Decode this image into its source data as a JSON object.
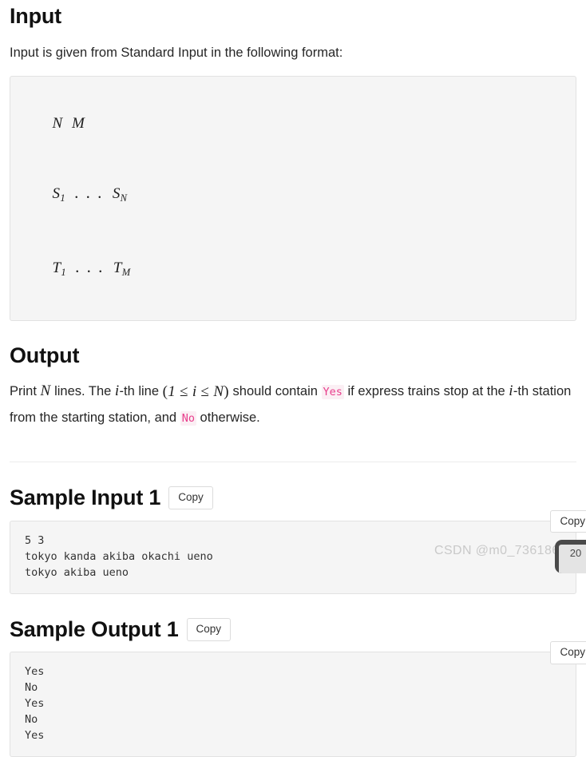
{
  "sections": {
    "input": {
      "heading": "Input",
      "description": "Input is given from Standard Input in the following format:",
      "format_lines": [
        {
          "tokens": [
            {
              "text": "N"
            },
            {
              "text": "M"
            }
          ]
        },
        {
          "tokens": [
            {
              "text": "S",
              "sub": "1"
            },
            {
              "text": "…"
            },
            {
              "text": "S",
              "sub": "N"
            }
          ]
        },
        {
          "tokens": [
            {
              "text": "T",
              "sub": "1"
            },
            {
              "text": "…"
            },
            {
              "text": "T",
              "sub": "M"
            }
          ]
        }
      ],
      "format_plain": "N M\nS_1 ... S_N\nT_1 ... T_M"
    },
    "output": {
      "heading": "Output",
      "text_part_1": "Print ",
      "math_n_1": "N",
      "text_part_2": " lines. The ",
      "math_i_1": "i",
      "text_part_3": "-th line ",
      "math_range": "(1 ≤ i ≤ N)",
      "text_part_4": " should contain ",
      "code_yes": "Yes",
      "text_part_5": " if express trains stop at the ",
      "math_i_2": "i",
      "text_part_6": "-th station from the starting station, and ",
      "code_no": "No",
      "text_part_7": " otherwise."
    },
    "sample_input_1": {
      "heading": "Sample Input 1",
      "copy_label": "Copy",
      "copy_label_corner": "Copy",
      "content": "5 3\ntokyo kanda akiba okachi ueno\ntokyo akiba ueno"
    },
    "sample_output_1": {
      "heading": "Sample Output 1",
      "copy_label": "Copy",
      "copy_label_corner": "Copy",
      "content": "Yes\nNo\nYes\nNo\nYes"
    }
  },
  "watermark": {
    "text": "CSDN @m0_73618658"
  },
  "float_widget": {
    "value": "20"
  },
  "colors": {
    "code_bg": "#f5f5f5",
    "code_border": "#e2e2e2",
    "inline_code_fg": "#e83e8c",
    "inline_code_bg": "#fbeff4",
    "text": "#262626",
    "heading": "#111111",
    "divider": "#ececec",
    "watermark": "#c9c9c9",
    "widget_bg": "#4a4a4a"
  }
}
